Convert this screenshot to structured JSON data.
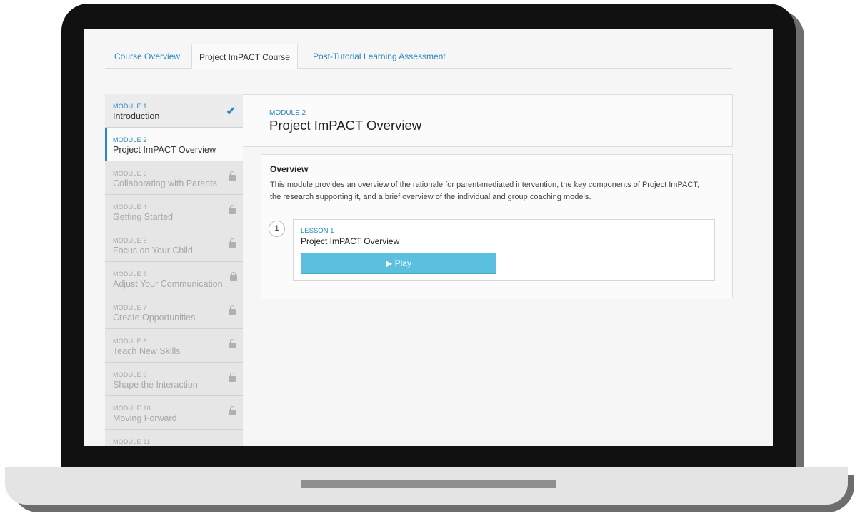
{
  "tabs": [
    {
      "label": "Course Overview"
    },
    {
      "label": "Project ImPACT Course"
    },
    {
      "label": "Post-Tutorial Learning Assessment"
    }
  ],
  "active_tab": "Project ImPACT Course",
  "sidebar": {
    "modules": [
      {
        "number": "MODULE 1",
        "title": "Introduction",
        "status": "completed"
      },
      {
        "number": "MODULE 2",
        "title": "Project ImPACT Overview",
        "status": "active"
      },
      {
        "number": "MODULE 3",
        "title": "Collaborating with Parents",
        "status": "locked"
      },
      {
        "number": "MODULE 4",
        "title": "Getting Started",
        "status": "locked"
      },
      {
        "number": "MODULE 5",
        "title": "Focus on Your Child",
        "status": "locked"
      },
      {
        "number": "MODULE 6",
        "title": "Adjust Your Communication",
        "status": "locked"
      },
      {
        "number": "MODULE 7",
        "title": "Create Opportunities",
        "status": "locked"
      },
      {
        "number": "MODULE 8",
        "title": "Teach New Skills",
        "status": "locked"
      },
      {
        "number": "MODULE 9",
        "title": "Shape the Interaction",
        "status": "locked"
      },
      {
        "number": "MODULE 10",
        "title": "Moving Forward",
        "status": "locked"
      },
      {
        "number": "MODULE 11",
        "title": "",
        "status": "locked"
      }
    ]
  },
  "main": {
    "module_number": "MODULE 2",
    "module_title": "Project ImPACT Overview",
    "overview_title": "Overview",
    "overview_text": "This module provides an overview of the rationale for parent-mediated intervention, the key components of Project ImPACT, the research supporting it, and a brief overview of the individual and group coaching models.",
    "lesson": {
      "index": "1",
      "number": "LESSON 1",
      "title": "Project ImPACT Overview",
      "play_label": "▶  Play"
    }
  },
  "colors": {
    "accent": "#2a87c2",
    "play_button": "#5bc0e0",
    "laptop_frame": "#111111"
  },
  "icons": {
    "completed": "checkmark-icon",
    "locked": "lock-icon",
    "play": "play-icon"
  }
}
